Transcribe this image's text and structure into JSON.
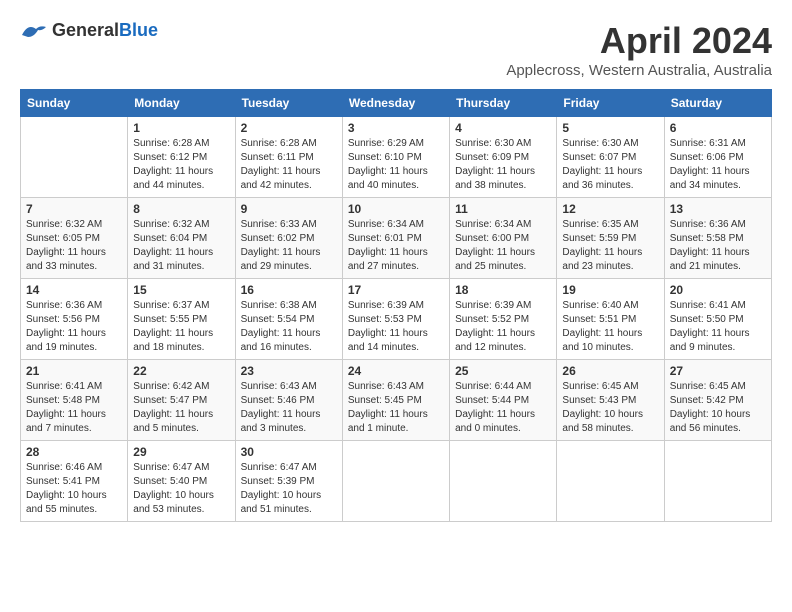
{
  "header": {
    "logo_general": "General",
    "logo_blue": "Blue",
    "month_title": "April 2024",
    "subtitle": "Applecross, Western Australia, Australia"
  },
  "days_of_week": [
    "Sunday",
    "Monday",
    "Tuesday",
    "Wednesday",
    "Thursday",
    "Friday",
    "Saturday"
  ],
  "weeks": [
    [
      {
        "date": "",
        "info": ""
      },
      {
        "date": "1",
        "info": "Sunrise: 6:28 AM\nSunset: 6:12 PM\nDaylight: 11 hours\nand 44 minutes."
      },
      {
        "date": "2",
        "info": "Sunrise: 6:28 AM\nSunset: 6:11 PM\nDaylight: 11 hours\nand 42 minutes."
      },
      {
        "date": "3",
        "info": "Sunrise: 6:29 AM\nSunset: 6:10 PM\nDaylight: 11 hours\nand 40 minutes."
      },
      {
        "date": "4",
        "info": "Sunrise: 6:30 AM\nSunset: 6:09 PM\nDaylight: 11 hours\nand 38 minutes."
      },
      {
        "date": "5",
        "info": "Sunrise: 6:30 AM\nSunset: 6:07 PM\nDaylight: 11 hours\nand 36 minutes."
      },
      {
        "date": "6",
        "info": "Sunrise: 6:31 AM\nSunset: 6:06 PM\nDaylight: 11 hours\nand 34 minutes."
      }
    ],
    [
      {
        "date": "7",
        "info": "Sunrise: 6:32 AM\nSunset: 6:05 PM\nDaylight: 11 hours\nand 33 minutes."
      },
      {
        "date": "8",
        "info": "Sunrise: 6:32 AM\nSunset: 6:04 PM\nDaylight: 11 hours\nand 31 minutes."
      },
      {
        "date": "9",
        "info": "Sunrise: 6:33 AM\nSunset: 6:02 PM\nDaylight: 11 hours\nand 29 minutes."
      },
      {
        "date": "10",
        "info": "Sunrise: 6:34 AM\nSunset: 6:01 PM\nDaylight: 11 hours\nand 27 minutes."
      },
      {
        "date": "11",
        "info": "Sunrise: 6:34 AM\nSunset: 6:00 PM\nDaylight: 11 hours\nand 25 minutes."
      },
      {
        "date": "12",
        "info": "Sunrise: 6:35 AM\nSunset: 5:59 PM\nDaylight: 11 hours\nand 23 minutes."
      },
      {
        "date": "13",
        "info": "Sunrise: 6:36 AM\nSunset: 5:58 PM\nDaylight: 11 hours\nand 21 minutes."
      }
    ],
    [
      {
        "date": "14",
        "info": "Sunrise: 6:36 AM\nSunset: 5:56 PM\nDaylight: 11 hours\nand 19 minutes."
      },
      {
        "date": "15",
        "info": "Sunrise: 6:37 AM\nSunset: 5:55 PM\nDaylight: 11 hours\nand 18 minutes."
      },
      {
        "date": "16",
        "info": "Sunrise: 6:38 AM\nSunset: 5:54 PM\nDaylight: 11 hours\nand 16 minutes."
      },
      {
        "date": "17",
        "info": "Sunrise: 6:39 AM\nSunset: 5:53 PM\nDaylight: 11 hours\nand 14 minutes."
      },
      {
        "date": "18",
        "info": "Sunrise: 6:39 AM\nSunset: 5:52 PM\nDaylight: 11 hours\nand 12 minutes."
      },
      {
        "date": "19",
        "info": "Sunrise: 6:40 AM\nSunset: 5:51 PM\nDaylight: 11 hours\nand 10 minutes."
      },
      {
        "date": "20",
        "info": "Sunrise: 6:41 AM\nSunset: 5:50 PM\nDaylight: 11 hours\nand 9 minutes."
      }
    ],
    [
      {
        "date": "21",
        "info": "Sunrise: 6:41 AM\nSunset: 5:48 PM\nDaylight: 11 hours\nand 7 minutes."
      },
      {
        "date": "22",
        "info": "Sunrise: 6:42 AM\nSunset: 5:47 PM\nDaylight: 11 hours\nand 5 minutes."
      },
      {
        "date": "23",
        "info": "Sunrise: 6:43 AM\nSunset: 5:46 PM\nDaylight: 11 hours\nand 3 minutes."
      },
      {
        "date": "24",
        "info": "Sunrise: 6:43 AM\nSunset: 5:45 PM\nDaylight: 11 hours\nand 1 minute."
      },
      {
        "date": "25",
        "info": "Sunrise: 6:44 AM\nSunset: 5:44 PM\nDaylight: 11 hours\nand 0 minutes."
      },
      {
        "date": "26",
        "info": "Sunrise: 6:45 AM\nSunset: 5:43 PM\nDaylight: 10 hours\nand 58 minutes."
      },
      {
        "date": "27",
        "info": "Sunrise: 6:45 AM\nSunset: 5:42 PM\nDaylight: 10 hours\nand 56 minutes."
      }
    ],
    [
      {
        "date": "28",
        "info": "Sunrise: 6:46 AM\nSunset: 5:41 PM\nDaylight: 10 hours\nand 55 minutes."
      },
      {
        "date": "29",
        "info": "Sunrise: 6:47 AM\nSunset: 5:40 PM\nDaylight: 10 hours\nand 53 minutes."
      },
      {
        "date": "30",
        "info": "Sunrise: 6:47 AM\nSunset: 5:39 PM\nDaylight: 10 hours\nand 51 minutes."
      },
      {
        "date": "",
        "info": ""
      },
      {
        "date": "",
        "info": ""
      },
      {
        "date": "",
        "info": ""
      },
      {
        "date": "",
        "info": ""
      }
    ]
  ]
}
